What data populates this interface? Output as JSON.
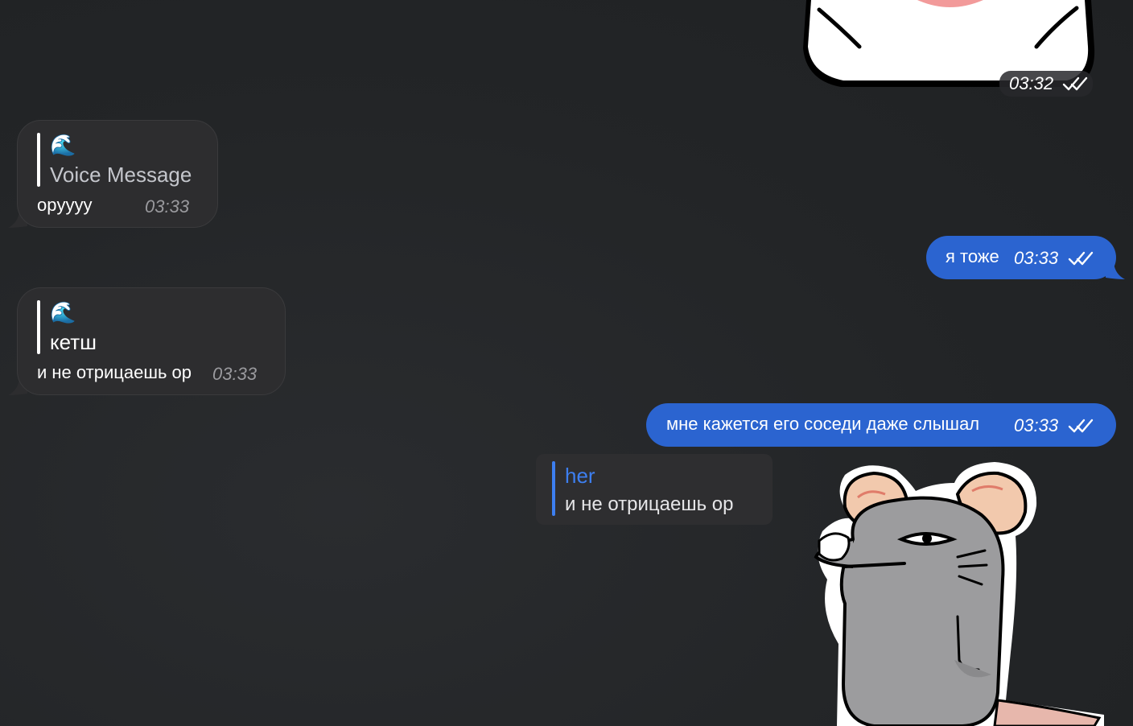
{
  "messages": [
    {
      "kind": "sticker",
      "direction": "outgoing",
      "time": "03:32",
      "status": "read",
      "sticker_name": "white-cat-sticker"
    },
    {
      "kind": "reply",
      "direction": "incoming",
      "reply_icon": "🌊",
      "reply_text": "Voice Message",
      "text": "opyyyy",
      "time": "03:33"
    },
    {
      "kind": "text",
      "direction": "outgoing",
      "text": "я тоже",
      "time": "03:33",
      "status": "read"
    },
    {
      "kind": "reply",
      "direction": "incoming",
      "reply_icon": "🌊",
      "reply_text": "кетш",
      "text": "и не отрицаешь ор",
      "time": "03:33"
    },
    {
      "kind": "text",
      "direction": "outgoing",
      "text": "мне кажется его соседи даже слышал",
      "time": "03:33",
      "status": "read"
    },
    {
      "kind": "sticker-reply",
      "direction": "outgoing",
      "quote_name": "her",
      "quote_text": "и не отрицаешь ор",
      "sticker_name": "grey-mouse-sticker"
    }
  ],
  "colors": {
    "background": "#232527",
    "incoming_bubble": "#2d2d2f",
    "outgoing_bubble": "#2b64d0",
    "quote_accent": "#3d7ff0",
    "timestamp_incoming": "#9a9a9e"
  }
}
